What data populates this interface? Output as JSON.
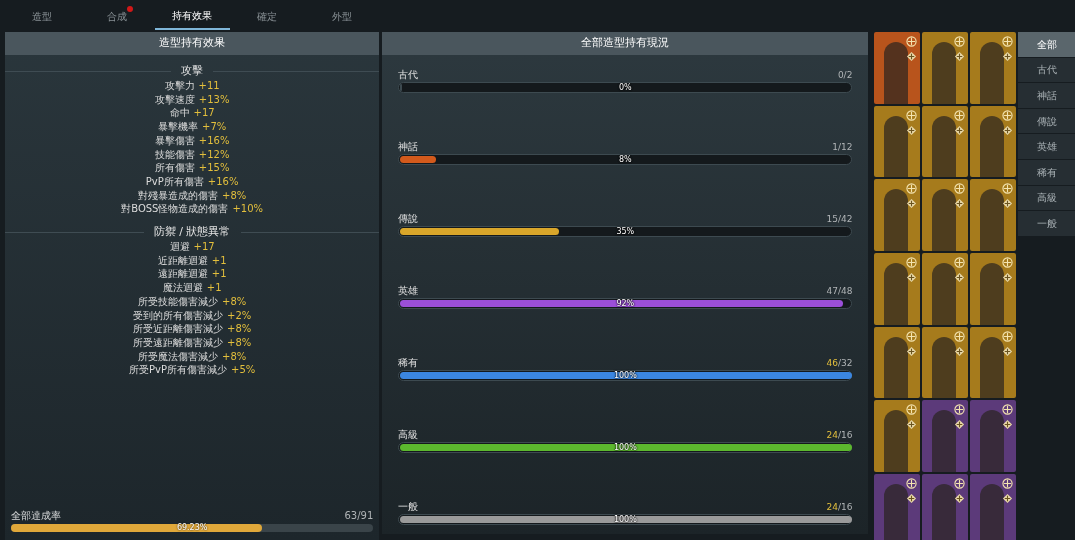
{
  "tabs": [
    {
      "label": "造型",
      "selected": false,
      "badge": false
    },
    {
      "label": "合成",
      "selected": false,
      "badge": true
    },
    {
      "label": "持有效果",
      "selected": true,
      "badge": false
    },
    {
      "label": "確定",
      "selected": false,
      "badge": false
    },
    {
      "label": "外型",
      "selected": false,
      "badge": false
    }
  ],
  "effects_panel": {
    "title": "造型持有效果",
    "sections": [
      {
        "title": "攻擊",
        "stats": [
          {
            "name": "攻擊力",
            "value": "+11"
          },
          {
            "name": "攻擊速度",
            "value": "+13%"
          },
          {
            "name": "命中",
            "value": "+17"
          },
          {
            "name": "暴擊機率",
            "value": "+7%"
          },
          {
            "name": "暴擊傷害",
            "value": "+16%"
          },
          {
            "name": "技能傷害",
            "value": "+12%"
          },
          {
            "name": "所有傷害",
            "value": "+15%"
          },
          {
            "name": "PvP所有傷害",
            "value": "+16%"
          },
          {
            "name": "對殘暴造成的傷害",
            "value": "+8%"
          },
          {
            "name": "對BOSS怪物造成的傷害",
            "value": "+10%"
          }
        ]
      },
      {
        "title": "防禦 / 狀態異常",
        "stats": [
          {
            "name": "迴避",
            "value": "+17"
          },
          {
            "name": "近距離迴避",
            "value": "+1"
          },
          {
            "name": "遠距離迴避",
            "value": "+1"
          },
          {
            "name": "魔法迴避",
            "value": "+1"
          },
          {
            "name": "所受技能傷害減少",
            "value": "+8%"
          },
          {
            "name": "受到的所有傷害減少",
            "value": "+2%"
          },
          {
            "name": "所受近距離傷害減少",
            "value": "+8%"
          },
          {
            "name": "所受遠距離傷害減少",
            "value": "+8%"
          },
          {
            "name": "所受魔法傷害減少",
            "value": "+8%"
          },
          {
            "name": "所受PvP所有傷害減少",
            "value": "+5%"
          }
        ]
      }
    ],
    "total": {
      "label": "全部達成率",
      "count": "63/91",
      "percent": "69.23%",
      "level": 0.6923
    }
  },
  "status_panel": {
    "title": "全部造型持有現況",
    "grades": [
      {
        "name": "古代",
        "owned": "0",
        "total": "/2",
        "complete": false,
        "percent": "0%",
        "level": 0
      },
      {
        "name": "神話",
        "owned": "1",
        "total": "/12",
        "complete": false,
        "percent": "8%",
        "level": 0.08,
        "color": "#d35a1c"
      },
      {
        "name": "傳說",
        "owned": "15",
        "total": "/42",
        "complete": false,
        "percent": "35%",
        "level": 0.35,
        "color": "#d9a62a"
      },
      {
        "name": "英雄",
        "owned": "47",
        "total": "/48",
        "complete": false,
        "percent": "92%",
        "level": 0.98,
        "color": "#9b4fd8"
      },
      {
        "name": "稀有",
        "owned": "46",
        "total": "/32",
        "complete": true,
        "percent": "100%",
        "level": 1,
        "color": "#3b86e0"
      },
      {
        "name": "高級",
        "owned": "24",
        "total": "/16",
        "complete": true,
        "percent": "100%",
        "level": 1,
        "color": "#5cb82e"
      },
      {
        "name": "一般",
        "owned": "24",
        "total": "/16",
        "complete": true,
        "percent": "100%",
        "level": 1,
        "color": "#9a9a9a"
      }
    ]
  },
  "costumes": [
    {
      "color": "#b8541c"
    },
    {
      "color": "#a67b1c"
    },
    {
      "color": "#a67b1c"
    },
    {
      "color": "#a67b1c"
    },
    {
      "color": "#a67b1c"
    },
    {
      "color": "#a67b1c"
    },
    {
      "color": "#a67b1c"
    },
    {
      "color": "#a67b1c"
    },
    {
      "color": "#a67b1c"
    },
    {
      "color": "#a67b1c"
    },
    {
      "color": "#a67b1c"
    },
    {
      "color": "#a67b1c"
    },
    {
      "color": "#a67b1c"
    },
    {
      "color": "#a67b1c"
    },
    {
      "color": "#a67b1c"
    },
    {
      "color": "#a67b1c"
    },
    {
      "color": "#5c3a7a"
    },
    {
      "color": "#5c3a7a"
    },
    {
      "color": "#5c3a7a"
    },
    {
      "color": "#5c3a7a"
    },
    {
      "color": "#5c3a7a"
    }
  ],
  "filters": [
    {
      "label": "全部",
      "selected": true
    },
    {
      "label": "古代",
      "selected": false
    },
    {
      "label": "神話",
      "selected": false
    },
    {
      "label": "傳說",
      "selected": false
    },
    {
      "label": "英雄",
      "selected": false
    },
    {
      "label": "稀有",
      "selected": false
    },
    {
      "label": "高級",
      "selected": false
    },
    {
      "label": "一般",
      "selected": false
    }
  ]
}
